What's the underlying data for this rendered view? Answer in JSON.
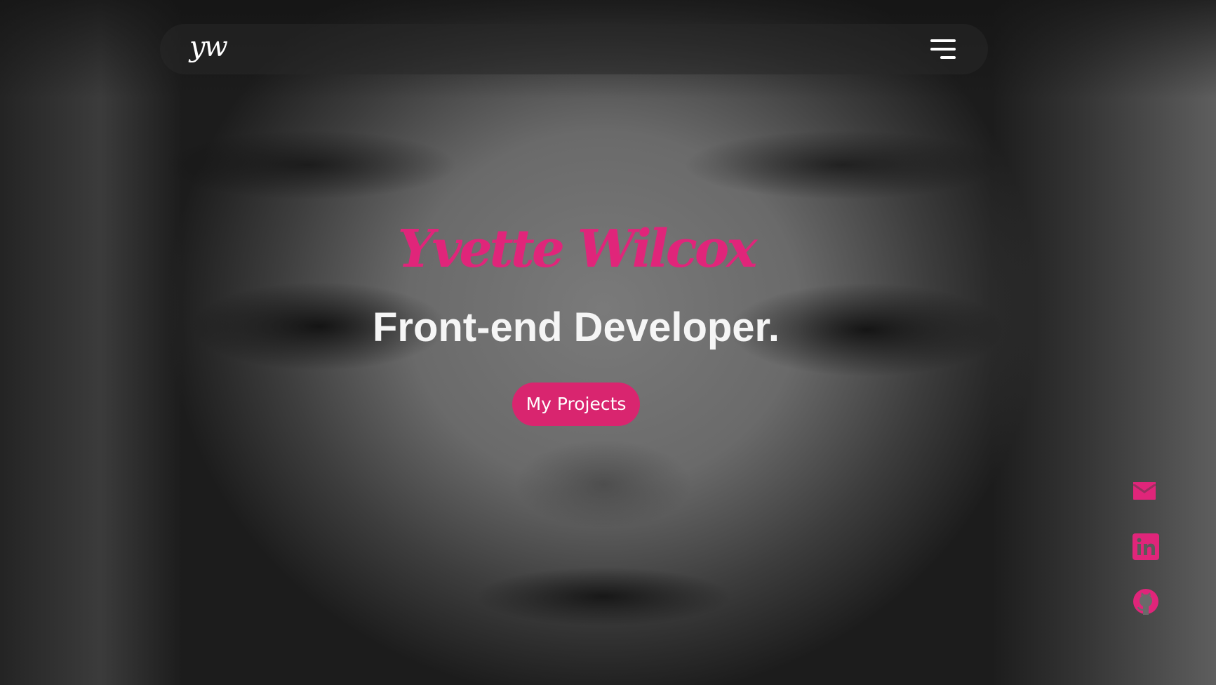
{
  "nav": {
    "logo_text": "yw",
    "menu_icon": "hamburger-menu-icon"
  },
  "hero": {
    "name": "Yvette Wilcox",
    "role": "Front-end Developer.",
    "cta_label": "My Projects"
  },
  "social": [
    {
      "icon": "mail-icon"
    },
    {
      "icon": "linkedin-icon"
    },
    {
      "icon": "github-icon"
    }
  ],
  "colors": {
    "accent": "#e0257a",
    "button": "#d9256f",
    "text": "#ffffff"
  }
}
